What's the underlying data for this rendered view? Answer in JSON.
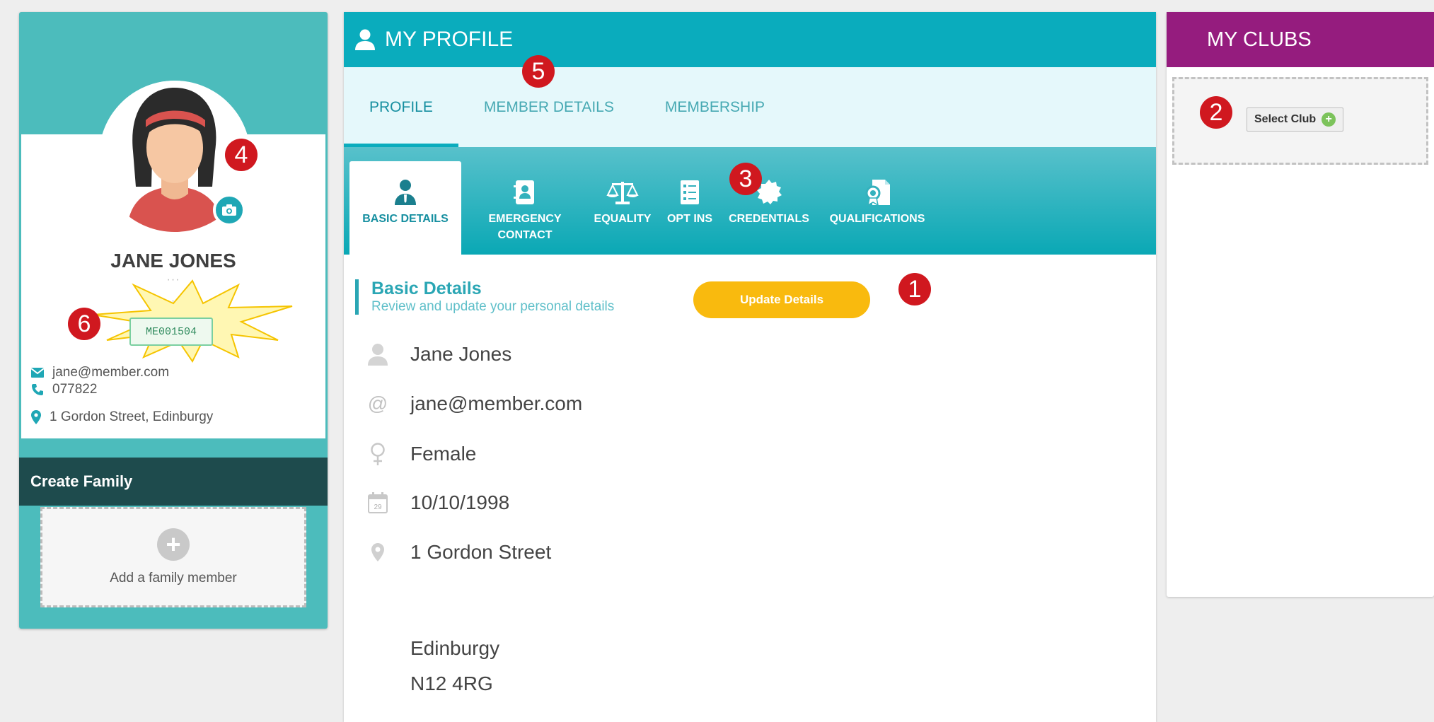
{
  "profile_card": {
    "name": "JANE JONES",
    "member_id": "ME001504",
    "email": "jane@member.com",
    "phone": "077822",
    "address": "1 Gordon Street, Edinburgy",
    "create_family_label": "Create Family",
    "add_family_label": "Add a family member"
  },
  "main": {
    "header_title": "MY PROFILE",
    "tabs": [
      {
        "label": "PROFILE"
      },
      {
        "label": "MEMBER DETAILS"
      },
      {
        "label": "MEMBERSHIP"
      }
    ],
    "subtabs": [
      {
        "label": "BASIC DETAILS",
        "icon": "person-icon"
      },
      {
        "label": "EMERGENCY CONTACT",
        "icon": "contact-card-icon"
      },
      {
        "label": "EQUALITY",
        "icon": "scales-icon"
      },
      {
        "label": "OPT INS",
        "icon": "checklist-icon"
      },
      {
        "label": "CREDENTIALS",
        "icon": "badge-icon"
      },
      {
        "label": "QUALIFICATIONS",
        "icon": "certificate-icon"
      }
    ],
    "section_title": "Basic Details",
    "section_subtitle": "Review and update your personal details",
    "update_button": "Update Details",
    "details": {
      "name": "Jane Jones",
      "email": "jane@member.com",
      "gender": "Female",
      "dob": "10/10/1998",
      "address_line1": "1 Gordon Street",
      "city": "Edinburgy",
      "postcode": "N12 4RG",
      "calendar_day": "29"
    }
  },
  "clubs": {
    "header_title": "MY CLUBS",
    "select_club_label": "Select Club"
  },
  "markers": [
    "1",
    "2",
    "3",
    "4",
    "5",
    "6"
  ],
  "colors": {
    "teal": "#0aacbd",
    "left_card": "#4cbcbc",
    "dark_teal": "#1e4b4d",
    "purple": "#951c7e",
    "update_button": "#f9ba0e",
    "marker": "#d0181f"
  }
}
